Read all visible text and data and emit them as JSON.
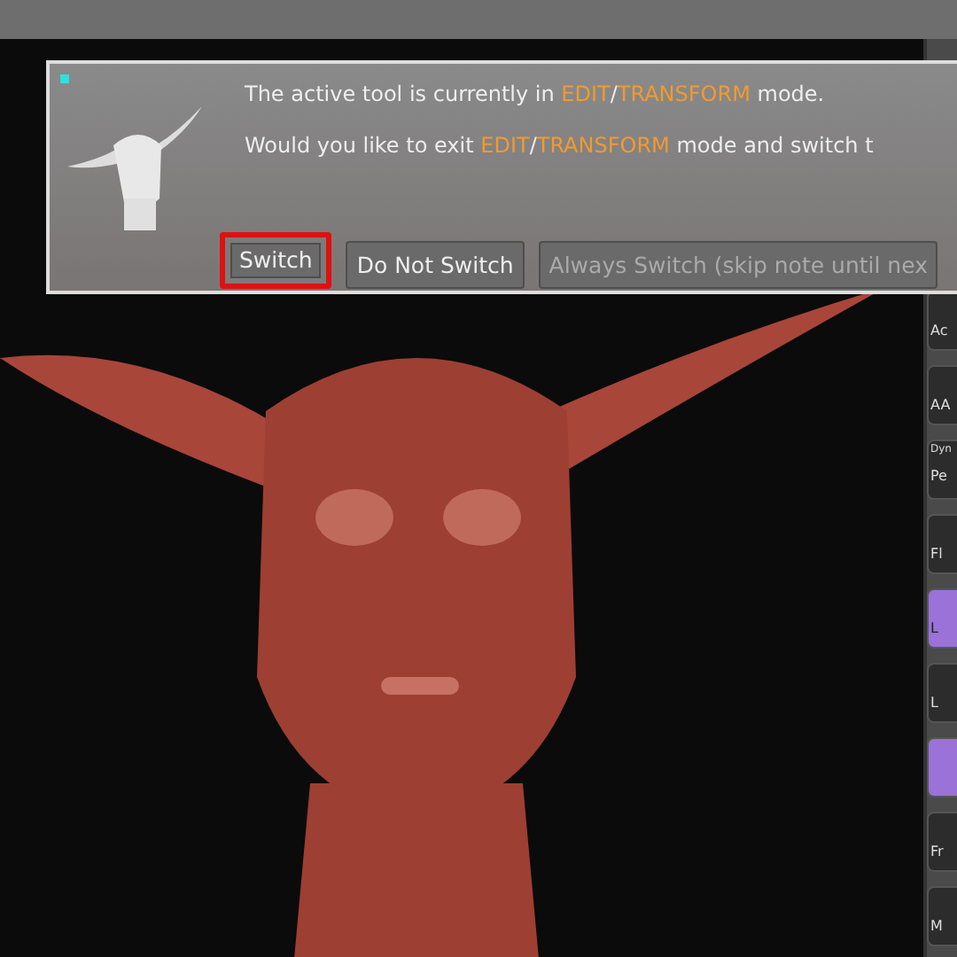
{
  "dialog": {
    "lines": [
      [
        {
          "text": "The active tool is currently in ",
          "highlight": false
        },
        {
          "text": "EDIT",
          "highlight": true
        },
        {
          "text": "/",
          "highlight": false
        },
        {
          "text": "TRANSFORM",
          "highlight": true
        },
        {
          "text": " mode.",
          "highlight": false
        }
      ],
      [
        {
          "text": "Would you like to exit ",
          "highlight": false
        },
        {
          "text": "EDIT",
          "highlight": true
        },
        {
          "text": "/",
          "highlight": false
        },
        {
          "text": "TRANSFORM",
          "highlight": true
        },
        {
          "text": " mode and switch t",
          "highlight": false
        }
      ]
    ],
    "buttons": [
      {
        "label": "Switch",
        "highlighted": true,
        "disabled": false
      },
      {
        "label": "Do Not Switch",
        "highlighted": false,
        "disabled": false
      },
      {
        "label": "Always Switch (skip note until nex",
        "highlighted": false,
        "disabled": true
      }
    ]
  },
  "shelf": [
    {
      "label": "Ac",
      "selected": false
    },
    {
      "label": "AA",
      "selected": false
    },
    {
      "label": "Pe",
      "caption": "Dyn",
      "selected": false
    },
    {
      "label": "Fl",
      "selected": false
    },
    {
      "label": "L",
      "selected": true
    },
    {
      "label": "L",
      "selected": false
    },
    {
      "selected": true
    },
    {
      "label": "Fr",
      "selected": false
    },
    {
      "label": "M",
      "selected": false
    }
  ]
}
